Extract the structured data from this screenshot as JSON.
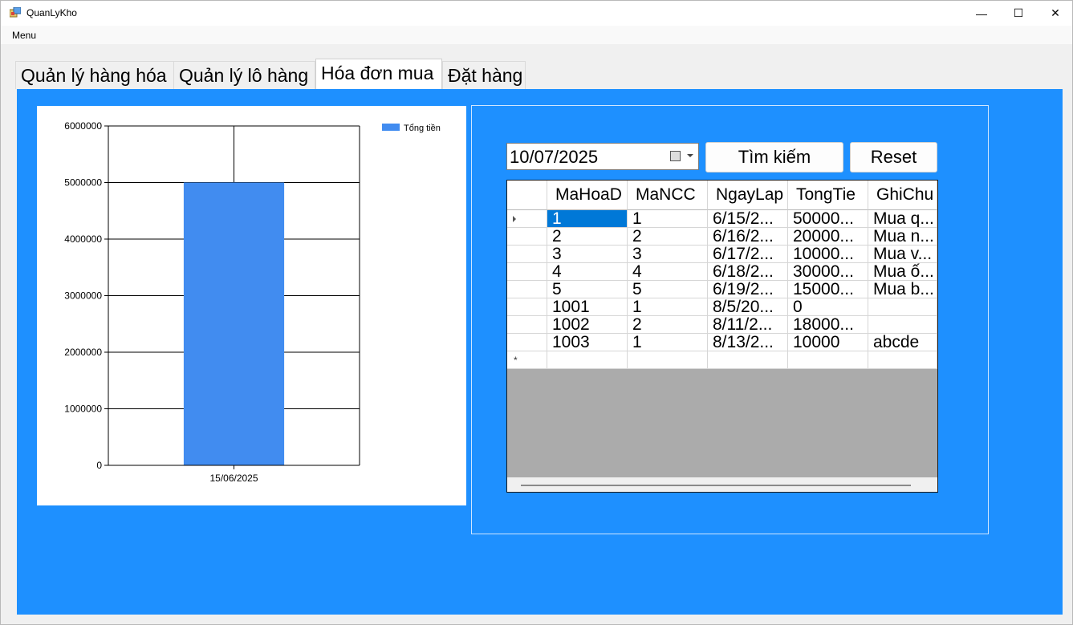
{
  "window": {
    "title": "QuanLyKho",
    "minimize_glyph": "—",
    "maximize_glyph": "☐",
    "close_glyph": "✕"
  },
  "menu": {
    "label": "Menu"
  },
  "tabs": [
    {
      "label": "Quản lý hàng hóa"
    },
    {
      "label": "Quản lý lô hàng"
    },
    {
      "label": "Hóa đơn mua",
      "active": true
    },
    {
      "label": "Đặt hàng"
    }
  ],
  "chart_data": {
    "type": "bar",
    "categories": [
      "15/06/2025"
    ],
    "series": [
      {
        "name": "Tổng tiền",
        "values": [
          5000000
        ],
        "color": "#418cf0"
      }
    ],
    "ylim": [
      0,
      6000000
    ],
    "yticks": [
      0,
      1000000,
      2000000,
      3000000,
      4000000,
      5000000,
      6000000
    ],
    "grid": true,
    "legend_position": "top-right",
    "title": "",
    "xlabel": "",
    "ylabel": ""
  },
  "search": {
    "date_value": "10/07/2025",
    "search_button": "Tìm kiếm",
    "reset_button": "Reset"
  },
  "table": {
    "columns": [
      "MaHoaD",
      "MaNCC",
      "NgayLap",
      "TongTie",
      "GhiChu"
    ],
    "rows": [
      [
        "1",
        "1",
        "6/15/2...",
        "50000...",
        "Mua q..."
      ],
      [
        "2",
        "2",
        "6/16/2...",
        "20000...",
        "Mua n..."
      ],
      [
        "3",
        "3",
        "6/17/2...",
        "10000...",
        "Mua v..."
      ],
      [
        "4",
        "4",
        "6/18/2...",
        "30000...",
        "Mua ố..."
      ],
      [
        "5",
        "5",
        "6/19/2...",
        "15000...",
        "Mua b..."
      ],
      [
        "1001",
        "1",
        "8/5/20...",
        "0",
        ""
      ],
      [
        "1002",
        "2",
        "8/11/2...",
        "18000...",
        ""
      ],
      [
        "1003",
        "1",
        "8/13/2...",
        "10000",
        "abcde"
      ]
    ],
    "new_row_marker": "*",
    "selected_cell": [
      0,
      0
    ]
  }
}
